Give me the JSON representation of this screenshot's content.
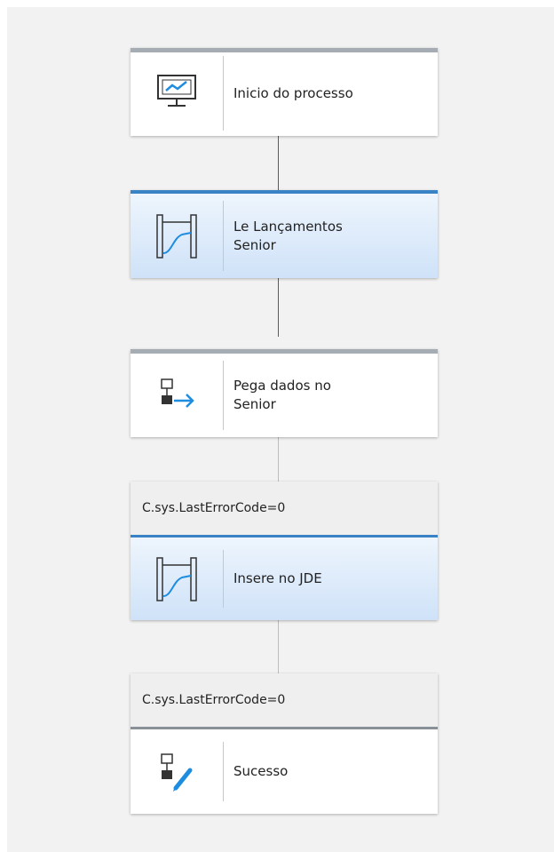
{
  "flow": {
    "nodes": [
      {
        "label": "Inicio do processo",
        "icon": "monitor-chart-icon"
      },
      {
        "label": "Le Lançamentos\nSenior",
        "icon": "loop-gate-icon"
      },
      {
        "label": "Pega dados no\nSenior",
        "icon": "flow-arrow-icon"
      },
      {
        "condition": "C.sys.LastErrorCode=0",
        "label": "Insere no JDE",
        "icon": "loop-gate-icon"
      },
      {
        "condition": "C.sys.LastErrorCode=0",
        "label": "Sucesso",
        "icon": "flow-edit-icon"
      }
    ]
  },
  "colors": {
    "accent_blue": "#3a82c6",
    "icon_blue": "#1e8de0",
    "canvas": "#f2f2f2"
  }
}
